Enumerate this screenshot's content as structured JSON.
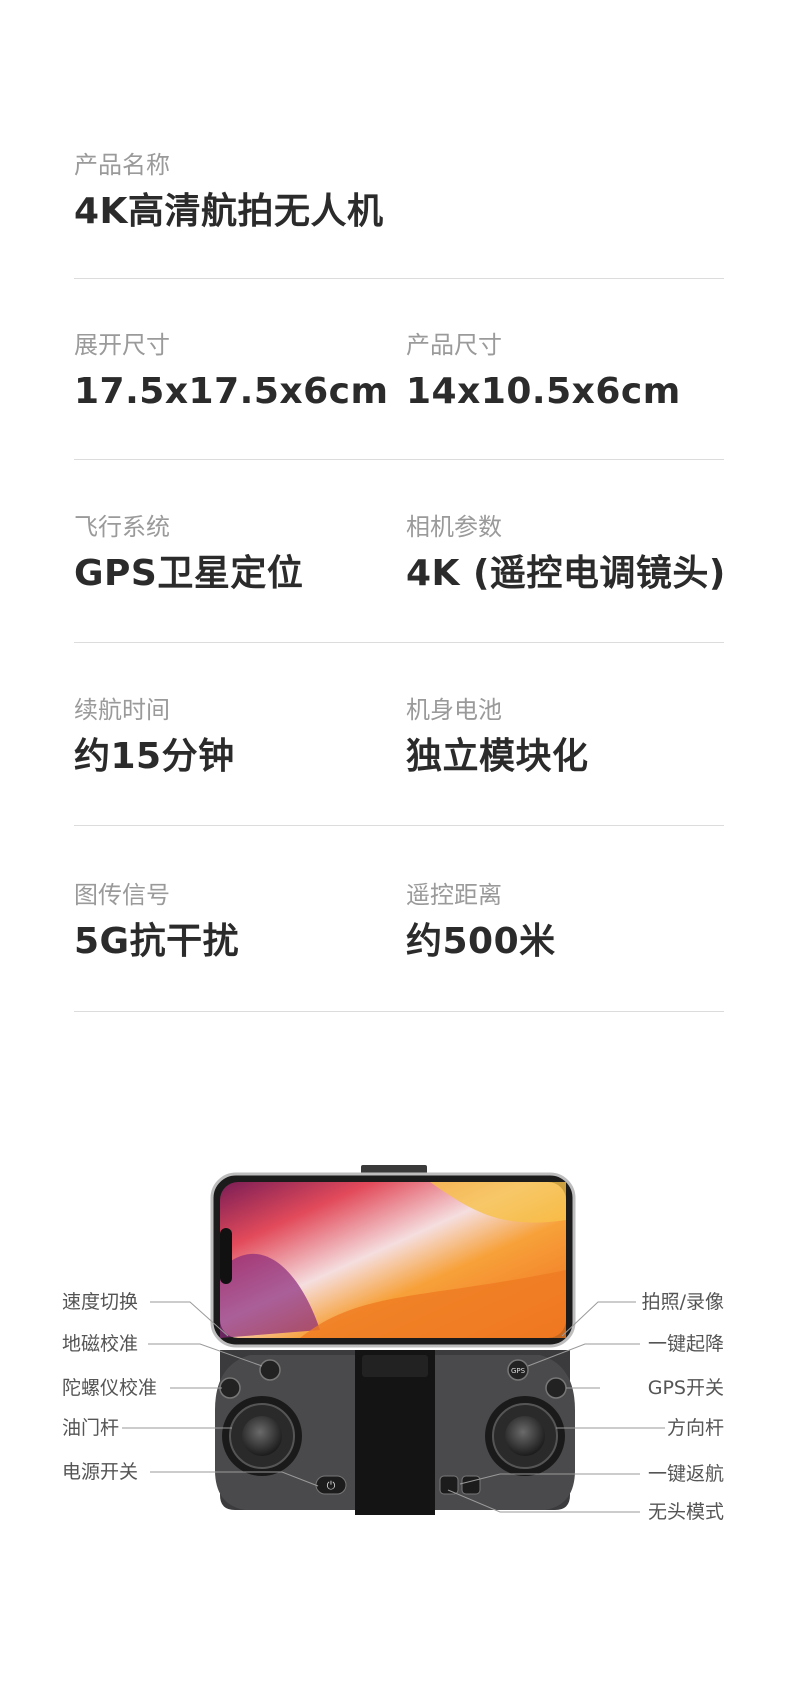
{
  "product_name": {
    "label": "产品名称",
    "value": "4K高清航拍无人机"
  },
  "rows": [
    {
      "left": {
        "label": "展开尺寸",
        "value": "17.5x17.5x6cm"
      },
      "right": {
        "label": "产品尺寸",
        "value": "14x10.5x6cm"
      }
    },
    {
      "left": {
        "label": "飞行系统",
        "value": "GPS卫星定位"
      },
      "right": {
        "label": "相机参数",
        "value": "4K (遥控电调镜头)"
      }
    },
    {
      "left": {
        "label": "续航时间",
        "value": "约15分钟"
      },
      "right": {
        "label": "机身电池",
        "value": "独立模块化"
      }
    },
    {
      "left": {
        "label": "图传信号",
        "value": "5G抗干扰"
      },
      "right": {
        "label": "遥控距离",
        "value": "约500米"
      }
    }
  ],
  "controller": {
    "left_callouts": [
      "速度切换",
      "地磁校准",
      "陀螺仪校准",
      "油门杆",
      "电源开关"
    ],
    "right_callouts": [
      "拍照/录像",
      "一键起降",
      "GPS开关",
      "方向杆",
      "一键返航",
      "无头模式"
    ],
    "gps_button_text": "GPS"
  }
}
